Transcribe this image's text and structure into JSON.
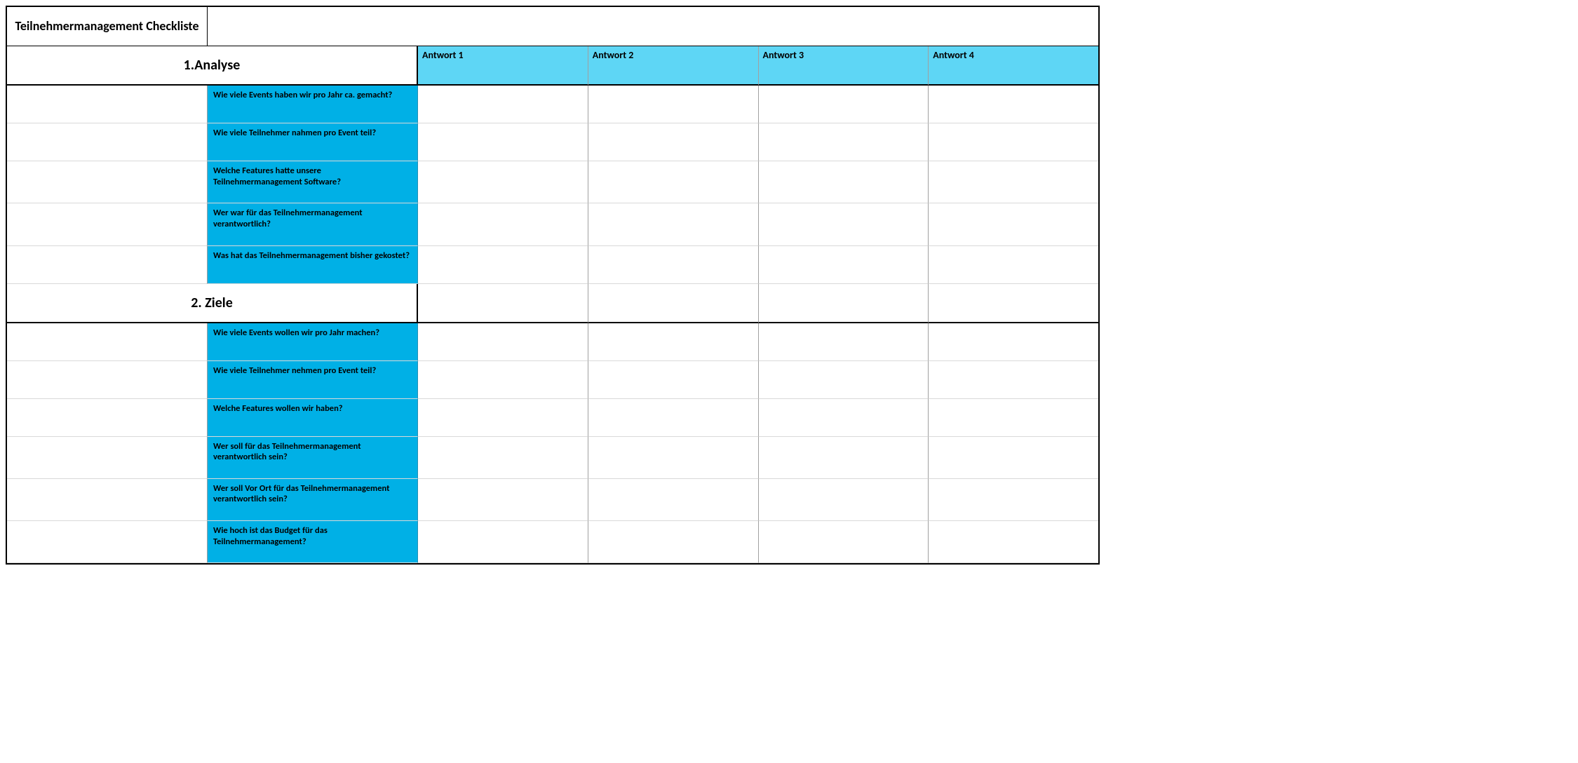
{
  "title": "Teilnehmermanagement Checkliste",
  "answer_headers": [
    "Antwort 1",
    "Antwort 2",
    "Antwort 3",
    "Antwort 4"
  ],
  "sections": [
    {
      "label": "1.Analyse",
      "questions": [
        "Wie viele Events haben wir pro Jahr ca. gemacht?",
        "Wie viele Teilnehmer nahmen pro Event teil?",
        "Welche Features hatte unsere Teilnehmermanagement Software?",
        "Wer war für das Teilnehmermanagement verantwortlich?",
        "Was hat das Teilnehmermanagement bisher gekostet?"
      ]
    },
    {
      "label": "2. Ziele",
      "questions": [
        "Wie viele Events wollen wir pro Jahr machen?",
        "Wie viele Teilnehmer nehmen pro Event teil?",
        "Welche Features wollen wir haben?",
        "Wer soll für das Teilnehmermanagement verantwortlich sein?",
        "Wer soll Vor Ort für das Teilnehmermanagement verantwortlich sein?",
        "Wie hoch ist das Budget für das Teilnehmermanagement?"
      ]
    }
  ]
}
